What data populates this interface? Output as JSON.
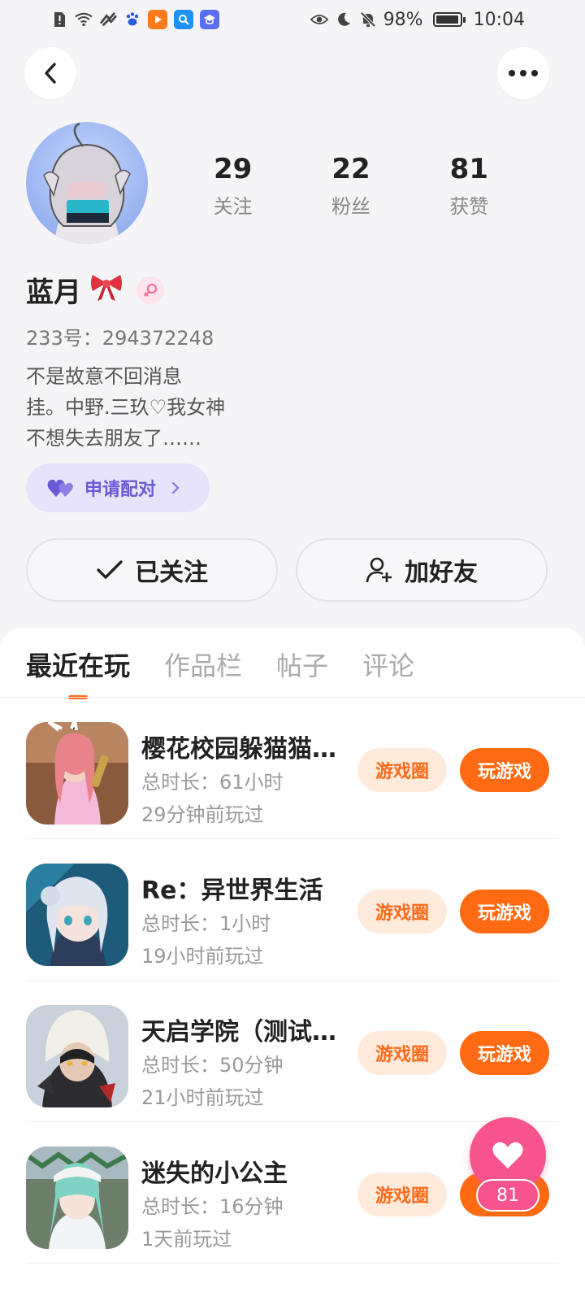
{
  "status_bar": {
    "battery": "98%",
    "battery_level": 0.98,
    "time": "10:04"
  },
  "profile": {
    "stats": [
      {
        "value": "29",
        "label": "关注"
      },
      {
        "value": "22",
        "label": "粉丝"
      },
      {
        "value": "81",
        "label": "获赞"
      }
    ],
    "name": "蓝月",
    "id_text": "233号：294372248",
    "bio": [
      "不是故意不回消息",
      "挂。中野.三玖♡我女神",
      "不想失去朋友了……"
    ],
    "pair_label": "申请配对",
    "follow_label": "已关注",
    "add_friend_label": "加好友"
  },
  "tabs": [
    {
      "label": "最近在玩",
      "active": true
    },
    {
      "label": "作品栏",
      "active": false
    },
    {
      "label": "帖子",
      "active": false
    },
    {
      "label": "评论",
      "active": false
    }
  ],
  "games": [
    {
      "title": "樱花校园躲猫猫...",
      "duration": "总时长：61小时",
      "last_played": "29分钟前玩过",
      "circle_label": "游戏圈",
      "play_label": "玩游戏"
    },
    {
      "title": "Re：异世界生活",
      "duration": "总时长：1小时",
      "last_played": "19小时前玩过",
      "circle_label": "游戏圈",
      "play_label": "玩游戏"
    },
    {
      "title": "天启学院（测试...",
      "duration": "总时长：50分钟",
      "last_played": "21小时前玩过",
      "circle_label": "游戏圈",
      "play_label": "玩游戏"
    },
    {
      "title": "迷失的小公主",
      "duration": "总时长：16分钟",
      "last_played": "1天前玩过",
      "circle_label": "游戏圈",
      "play_label": "玩游戏"
    }
  ],
  "like_fab": {
    "count": "81"
  },
  "colors": {
    "accent_orange": "#ff6a13",
    "pair_purple": "#6a5ad6",
    "like_pink": "#f7548e"
  }
}
